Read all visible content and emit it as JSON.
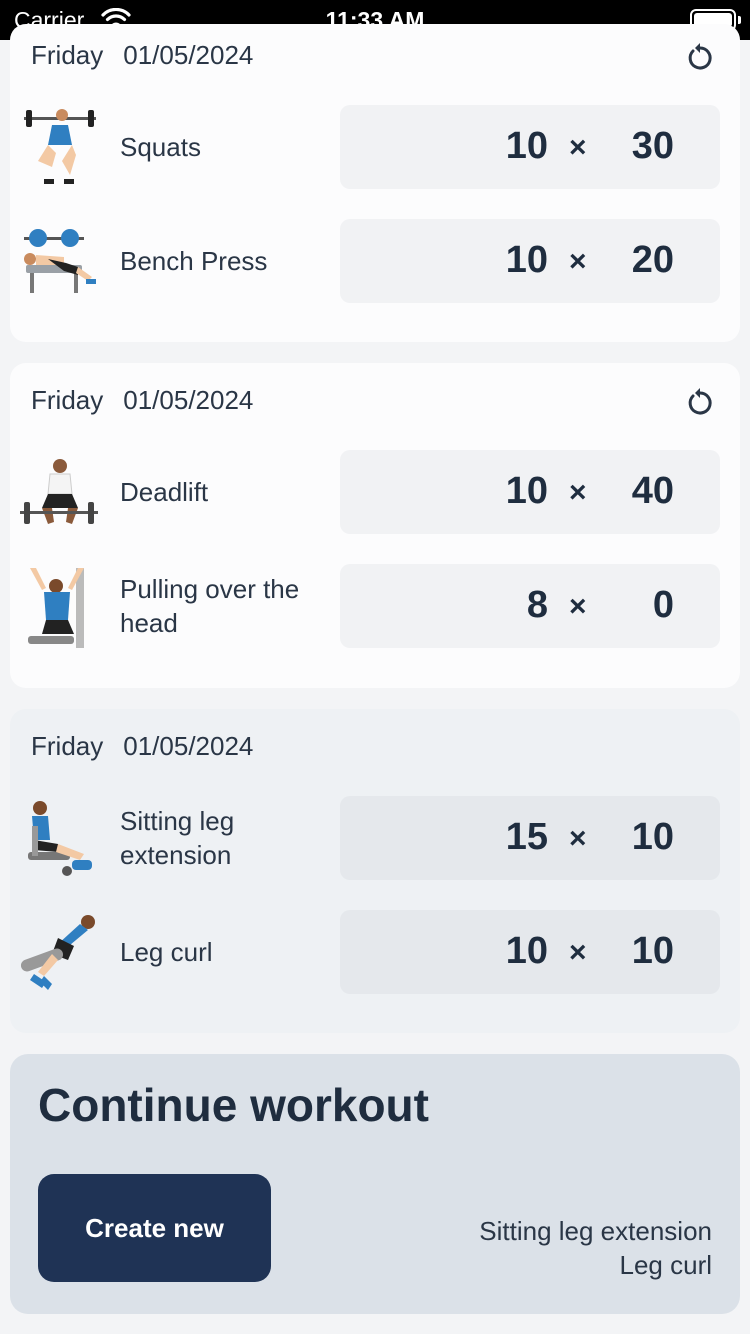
{
  "status_bar": {
    "carrier": "Carrier",
    "time": "11:33 AM"
  },
  "history": [
    {
      "day": "Friday",
      "date": "01/05/2024",
      "show_reset": true,
      "exercises": [
        {
          "name": "Squats",
          "reps": "10",
          "times": "×",
          "weight": "30",
          "icon": "squat-figure-icon"
        },
        {
          "name": "Bench Press",
          "reps": "10",
          "times": "×",
          "weight": "20",
          "icon": "bench-press-figure-icon"
        }
      ]
    },
    {
      "day": "Friday",
      "date": "01/05/2024",
      "show_reset": true,
      "exercises": [
        {
          "name": "Deadlift",
          "reps": "10",
          "times": "×",
          "weight": "40",
          "icon": "deadlift-figure-icon"
        },
        {
          "name": "Pulling over the head",
          "reps": "8",
          "times": "×",
          "weight": "0",
          "icon": "pulldown-figure-icon"
        }
      ]
    },
    {
      "day": "Friday",
      "date": "01/05/2024",
      "show_reset": false,
      "exercises": [
        {
          "name": "Sitting leg extension",
          "reps": "15",
          "times": "×",
          "weight": "10",
          "icon": "leg-extension-figure-icon"
        },
        {
          "name": "Leg curl",
          "reps": "10",
          "times": "×",
          "weight": "10",
          "icon": "leg-curl-figure-icon"
        }
      ]
    }
  ],
  "continue_workout": {
    "title": "Continue workout",
    "create_button": "Create new",
    "exercises": [
      "Sitting leg extension",
      "Leg curl"
    ]
  },
  "colors": {
    "accent": "#1f3355",
    "text": "#1f2d3f",
    "card": "#fcfcfd",
    "value_bg": "#f1f2f4",
    "panel": "#dbe1e8"
  }
}
